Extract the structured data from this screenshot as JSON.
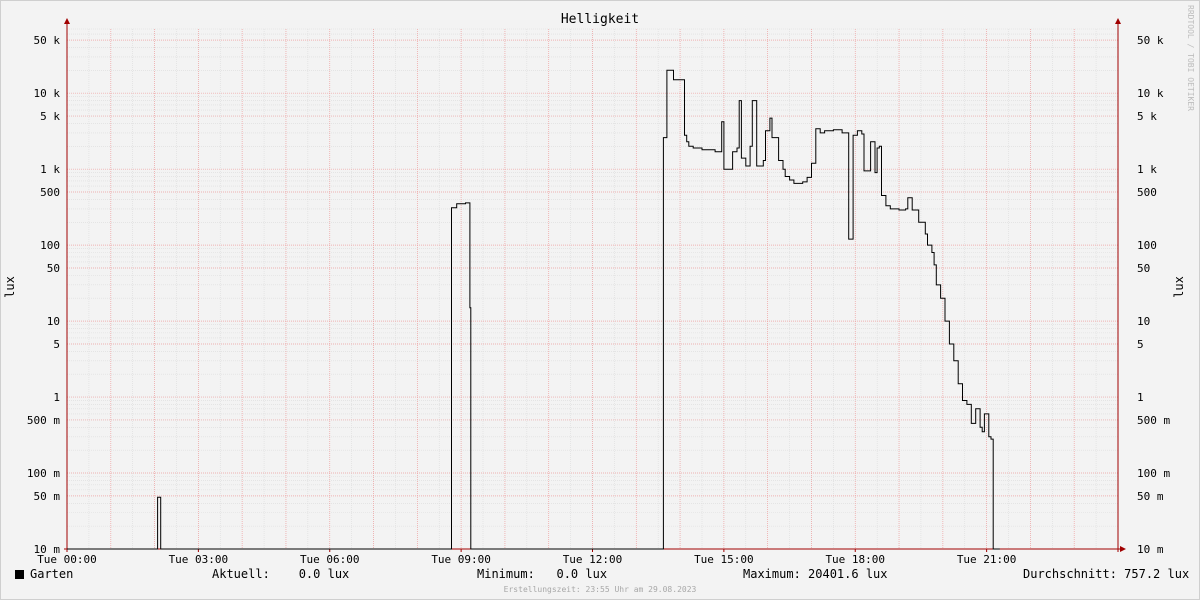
{
  "chart_data": {
    "type": "line",
    "title": "Helligkeit",
    "ylabel": "lux",
    "yscale": "log",
    "ylim": [
      0.01,
      70000
    ],
    "xlim": [
      0,
      24
    ],
    "x_tick_labels": [
      "Tue 00:00",
      "Tue 03:00",
      "Tue 06:00",
      "Tue 09:00",
      "Tue 12:00",
      "Tue 15:00",
      "Tue 18:00",
      "Tue 21:00"
    ],
    "x_tick_hours": [
      0,
      3,
      6,
      9,
      12,
      15,
      18,
      21
    ],
    "y_ticks": [
      {
        "v": 50000,
        "label": "50 k"
      },
      {
        "v": 10000,
        "label": "10 k"
      },
      {
        "v": 5000,
        "label": "5 k"
      },
      {
        "v": 1000,
        "label": "1 k"
      },
      {
        "v": 500,
        "label": "500"
      },
      {
        "v": 100,
        "label": "100"
      },
      {
        "v": 50,
        "label": "50"
      },
      {
        "v": 10,
        "label": "10"
      },
      {
        "v": 5,
        "label": "5"
      },
      {
        "v": 1,
        "label": "1"
      },
      {
        "v": 0.5,
        "label": "500 m"
      },
      {
        "v": 0.1,
        "label": "100 m"
      },
      {
        "v": 0.05,
        "label": "50 m"
      },
      {
        "v": 0.01,
        "label": "10 m"
      }
    ],
    "series": [
      {
        "name": "Garten",
        "color": "#000000",
        "x_hours": [
          0,
          2.05,
          2.07,
          2.12,
          2.14,
          8.75,
          8.78,
          8.9,
          9.1,
          9.15,
          9.2,
          9.22,
          9.25,
          13.6,
          13.62,
          13.7,
          13.72,
          13.85,
          13.9,
          14.1,
          14.15,
          14.2,
          14.3,
          14.5,
          14.8,
          14.95,
          15.0,
          15.1,
          15.2,
          15.3,
          15.35,
          15.4,
          15.5,
          15.6,
          15.65,
          15.75,
          15.85,
          15.9,
          15.95,
          16.05,
          16.1,
          16.25,
          16.35,
          16.4,
          16.5,
          16.6,
          16.8,
          16.9,
          17.0,
          17.1,
          17.2,
          17.3,
          17.5,
          17.7,
          17.85,
          17.9,
          17.95,
          18.05,
          18.15,
          18.2,
          18.3,
          18.35,
          18.45,
          18.5,
          18.55,
          18.6,
          18.7,
          18.8,
          19.0,
          19.15,
          19.2,
          19.3,
          19.45,
          19.6,
          19.65,
          19.75,
          19.8,
          19.85,
          19.95,
          20.05,
          20.15,
          20.25,
          20.35,
          20.45,
          20.55,
          20.65,
          20.75,
          20.85,
          20.9,
          20.95,
          21.05,
          21.1,
          21.15,
          21.25,
          21.3,
          21.35,
          21.45,
          21.5,
          21.55,
          21.6,
          21.65,
          21.7,
          21.75,
          21.85,
          24
        ],
        "values": [
          0.01,
          0.01,
          0.048,
          0.048,
          0.01,
          0.01,
          310,
          350,
          360,
          360,
          15,
          0.01,
          0.01,
          0.01,
          2600,
          20000,
          20000,
          15000,
          15000,
          2800,
          2300,
          2000,
          1900,
          1800,
          1700,
          4200,
          1000,
          1000,
          1700,
          1900,
          8000,
          1400,
          1100,
          2000,
          8000,
          1100,
          1100,
          1300,
          3200,
          4700,
          2600,
          1300,
          1000,
          800,
          720,
          650,
          680,
          780,
          1200,
          3400,
          3000,
          3200,
          3300,
          3000,
          120,
          120,
          2800,
          3200,
          2900,
          950,
          950,
          2300,
          900,
          1900,
          2000,
          450,
          330,
          300,
          290,
          300,
          420,
          290,
          200,
          140,
          100,
          80,
          55,
          30,
          20,
          10,
          5,
          3,
          1.5,
          0.9,
          0.8,
          0.45,
          0.7,
          0.4,
          0.35,
          0.6,
          0.3,
          0.28,
          0.01,
          0.01
        ],
        "aktuell": "0.0 lux",
        "minimum": "0.0 lux",
        "maximum": "20401.6 lux",
        "durchschnitt": "757.2 lux"
      }
    ]
  },
  "legend": {
    "series_name": "Garten",
    "aktuell_label": "Aktuell:",
    "aktuell_value": "0.0 lux",
    "minimum_label": "Minimum:",
    "minimum_value": "0.0 lux",
    "maximum_label": "Maximum:",
    "maximum_value": "20401.6 lux",
    "avg_label": "Durchschnitt:",
    "avg_value": "757.2 lux"
  },
  "footer": "Erstellungszeit: 23:55 Uhr am 29.08.2023",
  "watermark": "RRDTOOL / TOBI OETIKER",
  "colors": {
    "major_grid": "#f0a0a0",
    "minor_grid": "#dcdcdc",
    "axis": "#a00000",
    "line": "#000000"
  }
}
